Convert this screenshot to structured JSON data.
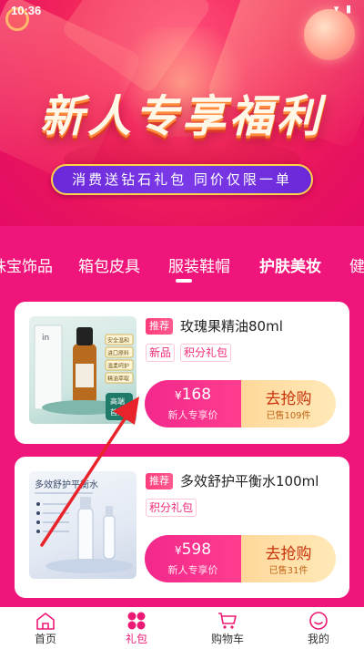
{
  "status_bar": {
    "time": "10:36",
    "icons": "▾ ▮"
  },
  "banner": {
    "title": "新人专享福利",
    "promo_text": "消费送钻石礼包 同价仅限一单"
  },
  "tabs": [
    {
      "label": "珠宝饰品",
      "active": false
    },
    {
      "label": "箱包皮具",
      "active": false
    },
    {
      "label": "服装鞋帽",
      "active": false
    },
    {
      "label": "护肤美妆",
      "active": true
    },
    {
      "label": "健",
      "active": false
    }
  ],
  "products": [
    {
      "badge": "推荐",
      "name": "玫瑰果精油80ml",
      "tags": [
        "新品",
        "积分礼包"
      ],
      "currency": "¥",
      "price": "168",
      "price_note": "新人专享价",
      "cta": "去抢购",
      "sold": "已售109件",
      "thumb_labels": [
        "高端",
        "首选"
      ],
      "thumb_side_labels": [
        "安全温和",
        "进口原料",
        "温柔呵护",
        "精油萃取"
      ]
    },
    {
      "badge": "推荐",
      "name": "多效舒护平衡水100ml",
      "tags": [
        "积分礼包"
      ],
      "currency": "¥",
      "price": "598",
      "price_note": "新人专享价",
      "cta": "去抢购",
      "sold": "已售31件",
      "thumb_heading": "多效舒护平衡水"
    }
  ],
  "bottom_nav": [
    {
      "label": "首页",
      "icon": "home-icon",
      "active": false
    },
    {
      "label": "礼包",
      "icon": "gift-grid-icon",
      "active": true
    },
    {
      "label": "购物车",
      "icon": "cart-icon",
      "active": false
    },
    {
      "label": "我的",
      "icon": "profile-icon",
      "active": false
    }
  ],
  "colors": {
    "brand_pink": "#f0157a",
    "active_nav": "#ec1a74",
    "cta_gold": "#ffe0a6",
    "annotation_arrow": "#e8232b"
  }
}
